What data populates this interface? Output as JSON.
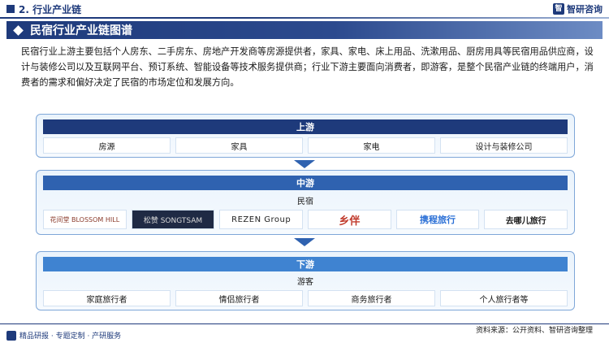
{
  "header": {
    "section": "2. 行业产业链",
    "brand": "智研咨询"
  },
  "title": "民宿行业产业链图谱",
  "intro": "民宿行业上游主要包括个人房东、二手房东、房地产开发商等房源提供者，家具、家电、床上用品、洗漱用品、厨房用具等民宿用品供应商，设计与装修公司以及互联网平台、预订系统、智能设备等技术服务提供商；行业下游主要面向消费者，即游客，是整个民宿产业链的终端用户，消费者的需求和偏好决定了民宿的市场定位和发展方向。",
  "upstream": {
    "title": "上游",
    "items": [
      "房源",
      "家具",
      "家电",
      "设计与装修公司"
    ]
  },
  "midstream": {
    "title": "中游",
    "label": "民宿",
    "logos": [
      "花间堂 BLOSSOM HILL",
      "松赞 SONGTSAM",
      "REZEN Group",
      "乡伴",
      "携程旅行",
      "去哪儿旅行"
    ]
  },
  "downstream": {
    "title": "下游",
    "label": "游客",
    "items": [
      "家庭旅行者",
      "情侣旅行者",
      "商务旅行者",
      "个人旅行者等"
    ]
  },
  "footer": {
    "left": "精品研报 · 专题定制 · 产研服务",
    "source": "资料来源：公开资料、智研咨询整理"
  },
  "colors": {
    "primary": "#1e3a7b",
    "mid": "#2f62b0",
    "light": "#3f83d1",
    "frame_border": "#7fa7d8"
  }
}
